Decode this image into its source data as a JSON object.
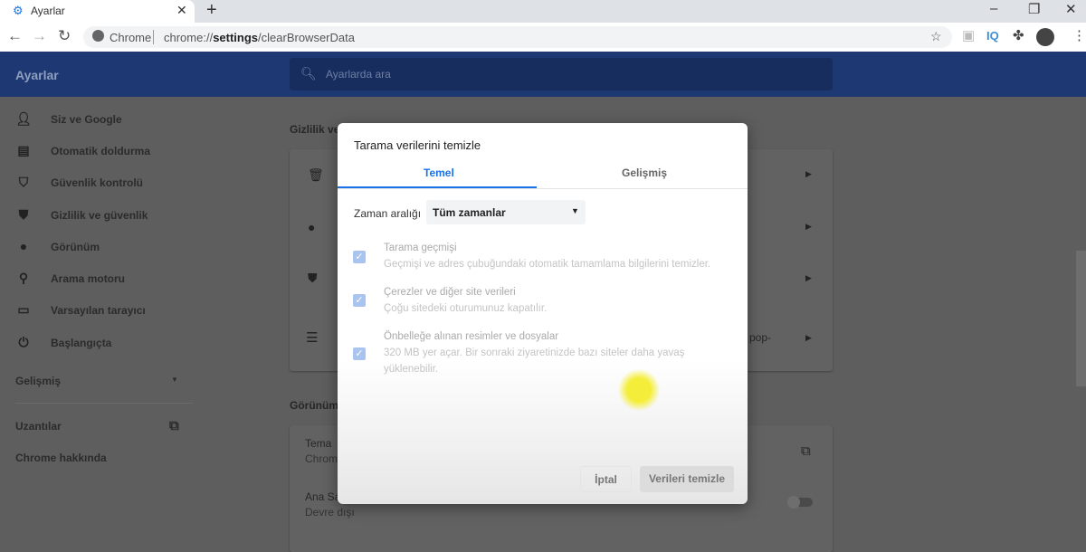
{
  "browser": {
    "tab_title": "Ayarlar",
    "tab_icon": "gear-icon",
    "omnibox_chip": "Chrome",
    "url_prefix": "chrome://",
    "url_bold": "settings",
    "url_suffix": "/clearBrowserData",
    "ext_iq": "IQ"
  },
  "header": {
    "title": "Ayarlar",
    "search_placeholder": "Ayarlarda ara"
  },
  "sidebar": {
    "items": [
      {
        "label": "Siz ve Google",
        "icon": "person-icon"
      },
      {
        "label": "Otomatik doldurma",
        "icon": "clipboard-icon"
      },
      {
        "label": "Güvenlik kontrolü",
        "icon": "shield-check-icon"
      },
      {
        "label": "Gizlilik ve güvenlik",
        "icon": "shield-icon"
      },
      {
        "label": "Görünüm",
        "icon": "palette-icon"
      },
      {
        "label": "Arama motoru",
        "icon": "search-icon"
      },
      {
        "label": "Varsayılan tarayıcı",
        "icon": "browser-icon"
      },
      {
        "label": "Başlangıçta",
        "icon": "power-icon"
      }
    ],
    "advanced": "Gelişmiş",
    "extensions": "Uzantılar",
    "about": "Chrome hakkında"
  },
  "background": {
    "privacy_heading": "Gizlilik ve",
    "pop_fragment": "pop-",
    "appearance_heading": "Görünüm",
    "theme_label": "Tema",
    "theme_value": "Chrom",
    "home_label": "Ana Sa",
    "home_value": "Devre dışı"
  },
  "dialog": {
    "title": "Tarama verilerini temizle",
    "tabs": [
      {
        "label": "Temel",
        "active": true
      },
      {
        "label": "Gelişmiş",
        "active": false
      }
    ],
    "time_range_label": "Zaman aralığı",
    "time_range_value": "Tüm zamanlar",
    "items": [
      {
        "title": "Tarama geçmişi",
        "desc": "Geçmişi ve adres çubuğundaki otomatik tamamlama bilgilerini temizler.",
        "checked": true
      },
      {
        "title": "Çerezler ve diğer site verileri",
        "desc": "Çoğu sitedeki oturumunuz kapatılır.",
        "checked": true
      },
      {
        "title": "Önbelleğe alınan resimler ve dosyalar",
        "desc": "320 MB yer açar. Bir sonraki ziyaretinizde bazı siteler daha yavaş yüklenebilir.",
        "checked": true
      }
    ],
    "cancel": "İptal",
    "clear": "Verileri temizle"
  },
  "colors": {
    "accent": "#1a73e8",
    "header": "#1d3872",
    "cursor_highlight": "#f4ee3a"
  }
}
